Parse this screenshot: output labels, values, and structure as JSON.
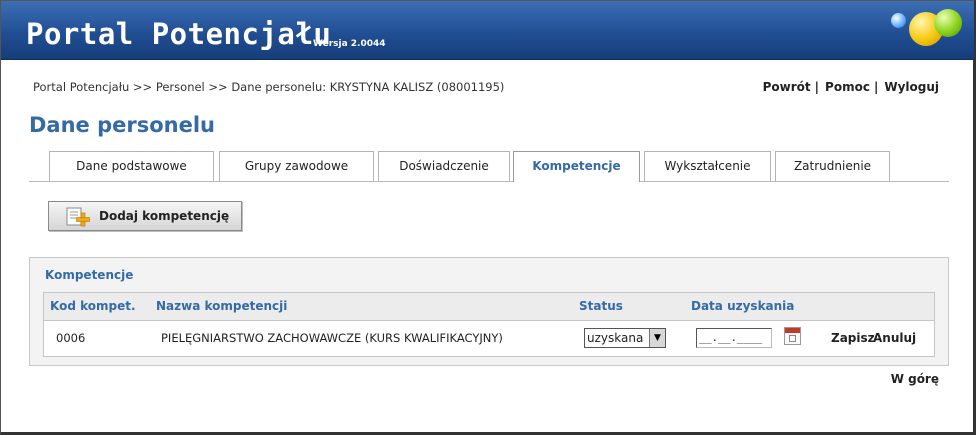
{
  "header": {
    "title": "Portal Potencjału",
    "version": "Wersja 2.0044"
  },
  "breadcrumb": "Portal Potencjału >> Personel >> Dane personelu: KRYSTYNA KALISZ (08001195)",
  "top_links": {
    "back": "Powrót",
    "help": "Pomoc",
    "logout": "Wyloguj",
    "separator": "|"
  },
  "page_title": "Dane personelu",
  "tabs": [
    {
      "label": "Dane podstawowe"
    },
    {
      "label": "Grupy zawodowe"
    },
    {
      "label": "Doświadczenie"
    },
    {
      "label": "Kompetencje"
    },
    {
      "label": "Wykształcenie"
    },
    {
      "label": "Zatrudnienie"
    }
  ],
  "active_tab": "Kompetencje",
  "add_button": {
    "label": "Dodaj kompetencję",
    "icon": "add-document-icon"
  },
  "panel": {
    "title": "Kompetencje",
    "columns": [
      "Kod kompet.",
      "Nazwa kompetencji",
      "Status",
      "Data uzyskania"
    ],
    "row": {
      "code": "0006",
      "name": "PIELĘGNIARSTWO ZACHOWAWCZE (KURS KWALIFIKACYJNY)",
      "status": "uzyskana",
      "date_value": "__.__.____",
      "save": "Zapisz",
      "cancel": "Anuluj"
    }
  },
  "back_to_top": "W górę",
  "colors": {
    "header_blue": "#214f94",
    "accent_blue": "#346aa6"
  }
}
